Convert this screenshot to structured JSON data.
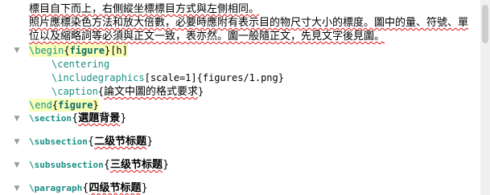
{
  "editor": {
    "lines": [
      {
        "text": "標目自下而上，右側縱坐標標目方式與左側相同。"
      },
      {
        "text": "照片應標染色方法和放大倍數，必要時應附有表示目的物尺寸大小的標度。圖中的量、符號、單"
      },
      {
        "text": "位以及縮略詞等必須與正文一致，表亦然。圖一般隨正文，先見文字後見圖。"
      }
    ],
    "figure": {
      "begin_cmd": "\\begin",
      "env": "figure",
      "opt": "[h]",
      "centering": "\\centering",
      "includegraphics": "\\includegraphics",
      "include_args": "[scale=1]{figures/1.png}",
      "caption_cmd": "\\caption",
      "caption_text": "論文中圖的格式要求",
      "end_cmd": "\\end",
      "end_env": "figure"
    },
    "section": {
      "cmd": "\\section",
      "title": "選題背景"
    },
    "subsection": {
      "cmd": "\\subsection",
      "title": "二级节标题"
    },
    "subsubsection": {
      "cmd": "\\subsubsection",
      "title": "三级节标题"
    },
    "paragraph": {
      "cmd": "\\paragraph",
      "title": "四级节标题"
    }
  },
  "icons": {
    "fold": "fold-arrow-icon"
  }
}
